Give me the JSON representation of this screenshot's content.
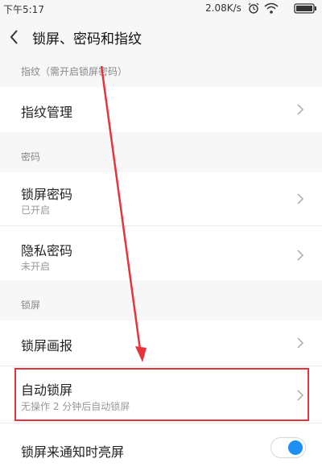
{
  "status_bar": {
    "time": "下午5:17",
    "net_speed": "2.08K/s",
    "icons": [
      "alarm-icon",
      "wifi-icon",
      "battery-icon"
    ]
  },
  "header": {
    "title": "锁屏、密码和指纹",
    "back_icon": "chevron-left-icon"
  },
  "sections": {
    "fingerprint": {
      "header": "指纹（需开启锁屏密码）",
      "manage_label": "指纹管理"
    },
    "password": {
      "header": "密码",
      "lock_password": {
        "title": "锁屏密码",
        "subtitle": "已开启"
      },
      "privacy_password": {
        "title": "隐私密码",
        "subtitle": "未开启"
      }
    },
    "lockscreen": {
      "header": "锁屏",
      "magazine": {
        "title": "锁屏画报"
      },
      "auto_lock": {
        "title": "自动锁屏",
        "subtitle": "无操作 2 分钟后自动锁屏"
      },
      "wake_on_notification": {
        "title": "锁屏来通知时亮屏",
        "enabled": true
      }
    }
  },
  "colors": {
    "accent": "#1f8ef1",
    "annotation": "#e8323c"
  }
}
